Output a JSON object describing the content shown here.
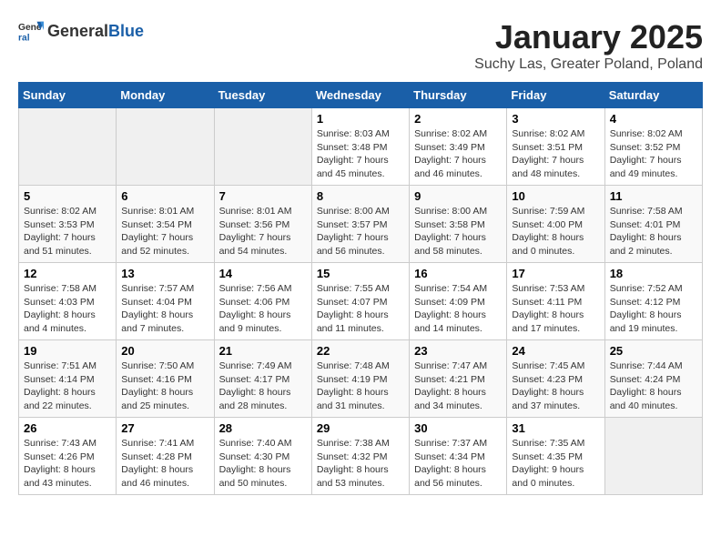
{
  "header": {
    "logo_general": "General",
    "logo_blue": "Blue",
    "title": "January 2025",
    "subtitle": "Suchy Las, Greater Poland, Poland"
  },
  "days_of_week": [
    "Sunday",
    "Monday",
    "Tuesday",
    "Wednesday",
    "Thursday",
    "Friday",
    "Saturday"
  ],
  "weeks": [
    [
      {
        "day": "",
        "info": ""
      },
      {
        "day": "",
        "info": ""
      },
      {
        "day": "",
        "info": ""
      },
      {
        "day": "1",
        "info": "Sunrise: 8:03 AM\nSunset: 3:48 PM\nDaylight: 7 hours and 45 minutes."
      },
      {
        "day": "2",
        "info": "Sunrise: 8:02 AM\nSunset: 3:49 PM\nDaylight: 7 hours and 46 minutes."
      },
      {
        "day": "3",
        "info": "Sunrise: 8:02 AM\nSunset: 3:51 PM\nDaylight: 7 hours and 48 minutes."
      },
      {
        "day": "4",
        "info": "Sunrise: 8:02 AM\nSunset: 3:52 PM\nDaylight: 7 hours and 49 minutes."
      }
    ],
    [
      {
        "day": "5",
        "info": "Sunrise: 8:02 AM\nSunset: 3:53 PM\nDaylight: 7 hours and 51 minutes."
      },
      {
        "day": "6",
        "info": "Sunrise: 8:01 AM\nSunset: 3:54 PM\nDaylight: 7 hours and 52 minutes."
      },
      {
        "day": "7",
        "info": "Sunrise: 8:01 AM\nSunset: 3:56 PM\nDaylight: 7 hours and 54 minutes."
      },
      {
        "day": "8",
        "info": "Sunrise: 8:00 AM\nSunset: 3:57 PM\nDaylight: 7 hours and 56 minutes."
      },
      {
        "day": "9",
        "info": "Sunrise: 8:00 AM\nSunset: 3:58 PM\nDaylight: 7 hours and 58 minutes."
      },
      {
        "day": "10",
        "info": "Sunrise: 7:59 AM\nSunset: 4:00 PM\nDaylight: 8 hours and 0 minutes."
      },
      {
        "day": "11",
        "info": "Sunrise: 7:58 AM\nSunset: 4:01 PM\nDaylight: 8 hours and 2 minutes."
      }
    ],
    [
      {
        "day": "12",
        "info": "Sunrise: 7:58 AM\nSunset: 4:03 PM\nDaylight: 8 hours and 4 minutes."
      },
      {
        "day": "13",
        "info": "Sunrise: 7:57 AM\nSunset: 4:04 PM\nDaylight: 8 hours and 7 minutes."
      },
      {
        "day": "14",
        "info": "Sunrise: 7:56 AM\nSunset: 4:06 PM\nDaylight: 8 hours and 9 minutes."
      },
      {
        "day": "15",
        "info": "Sunrise: 7:55 AM\nSunset: 4:07 PM\nDaylight: 8 hours and 11 minutes."
      },
      {
        "day": "16",
        "info": "Sunrise: 7:54 AM\nSunset: 4:09 PM\nDaylight: 8 hours and 14 minutes."
      },
      {
        "day": "17",
        "info": "Sunrise: 7:53 AM\nSunset: 4:11 PM\nDaylight: 8 hours and 17 minutes."
      },
      {
        "day": "18",
        "info": "Sunrise: 7:52 AM\nSunset: 4:12 PM\nDaylight: 8 hours and 19 minutes."
      }
    ],
    [
      {
        "day": "19",
        "info": "Sunrise: 7:51 AM\nSunset: 4:14 PM\nDaylight: 8 hours and 22 minutes."
      },
      {
        "day": "20",
        "info": "Sunrise: 7:50 AM\nSunset: 4:16 PM\nDaylight: 8 hours and 25 minutes."
      },
      {
        "day": "21",
        "info": "Sunrise: 7:49 AM\nSunset: 4:17 PM\nDaylight: 8 hours and 28 minutes."
      },
      {
        "day": "22",
        "info": "Sunrise: 7:48 AM\nSunset: 4:19 PM\nDaylight: 8 hours and 31 minutes."
      },
      {
        "day": "23",
        "info": "Sunrise: 7:47 AM\nSunset: 4:21 PM\nDaylight: 8 hours and 34 minutes."
      },
      {
        "day": "24",
        "info": "Sunrise: 7:45 AM\nSunset: 4:23 PM\nDaylight: 8 hours and 37 minutes."
      },
      {
        "day": "25",
        "info": "Sunrise: 7:44 AM\nSunset: 4:24 PM\nDaylight: 8 hours and 40 minutes."
      }
    ],
    [
      {
        "day": "26",
        "info": "Sunrise: 7:43 AM\nSunset: 4:26 PM\nDaylight: 8 hours and 43 minutes."
      },
      {
        "day": "27",
        "info": "Sunrise: 7:41 AM\nSunset: 4:28 PM\nDaylight: 8 hours and 46 minutes."
      },
      {
        "day": "28",
        "info": "Sunrise: 7:40 AM\nSunset: 4:30 PM\nDaylight: 8 hours and 50 minutes."
      },
      {
        "day": "29",
        "info": "Sunrise: 7:38 AM\nSunset: 4:32 PM\nDaylight: 8 hours and 53 minutes."
      },
      {
        "day": "30",
        "info": "Sunrise: 7:37 AM\nSunset: 4:34 PM\nDaylight: 8 hours and 56 minutes."
      },
      {
        "day": "31",
        "info": "Sunrise: 7:35 AM\nSunset: 4:35 PM\nDaylight: 9 hours and 0 minutes."
      },
      {
        "day": "",
        "info": ""
      }
    ]
  ]
}
